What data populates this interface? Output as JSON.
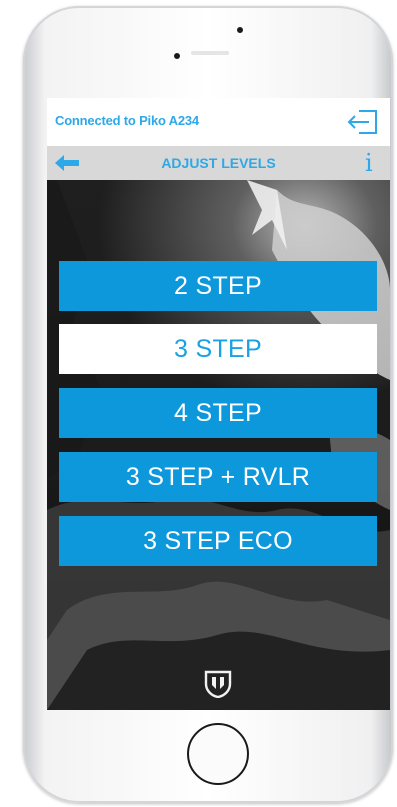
{
  "status_bar": {
    "connection_text": "Connected to Piko A234",
    "exit_icon": "exit-icon"
  },
  "nav_bar": {
    "title": "ADJUST LEVELS",
    "back_icon": "arrow-left-icon",
    "info_label": "i"
  },
  "level_options": [
    {
      "label": "2 STEP",
      "selected": false
    },
    {
      "label": "3 STEP",
      "selected": true
    },
    {
      "label": "4 STEP",
      "selected": false
    },
    {
      "label": "3 STEP + RVLR",
      "selected": false
    },
    {
      "label": "3 STEP ECO",
      "selected": false
    }
  ],
  "footer": {
    "logo_icon": "brand-logo-icon"
  },
  "colors": {
    "accent": "#0d98dc",
    "accent_text": "#2ea8e6",
    "nav_bg": "#d8d8d8",
    "selected_bg": "#ffffff"
  }
}
